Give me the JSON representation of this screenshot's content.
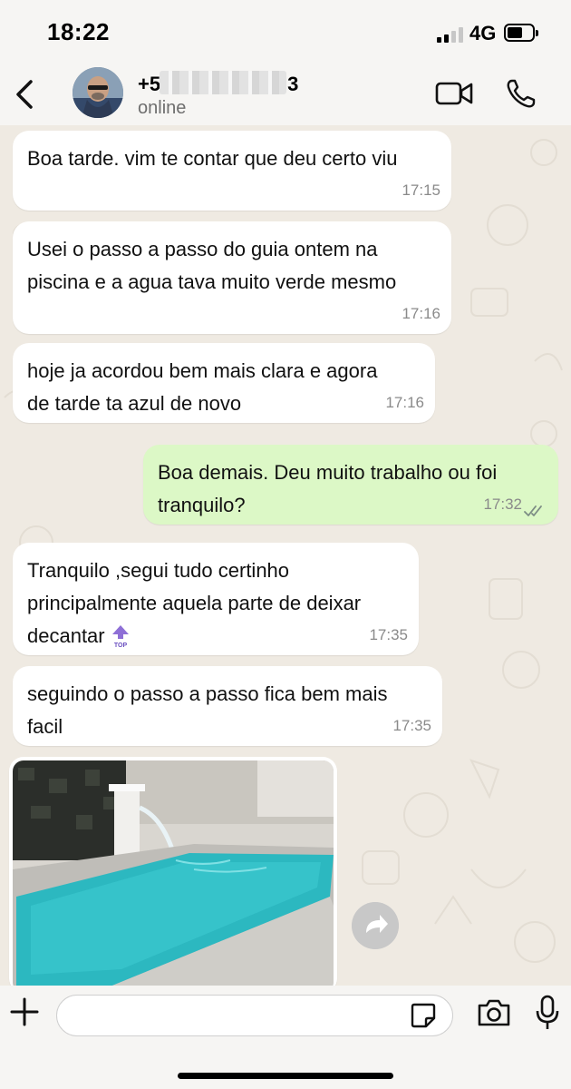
{
  "status_bar": {
    "time": "18:22",
    "network": "4G"
  },
  "header": {
    "contact_prefix": "+5",
    "contact_suffix": "3",
    "presence": "online"
  },
  "messages": [
    {
      "direction": "in",
      "text": "Boa tarde. vim te contar que deu certo viu",
      "time": "17:15"
    },
    {
      "direction": "in",
      "text": "Usei o passo a passo do guia ontem na\npiscina e a agua tava muito verde mesmo",
      "time": "17:16"
    },
    {
      "direction": "in",
      "text": "hoje ja acordou bem mais clara e agora\nde tarde ta azul de novo",
      "time": "17:16"
    },
    {
      "direction": "out",
      "text": "Boa demais. Deu muito trabalho ou foi\ntranquilo?",
      "time": "17:32",
      "status": "read"
    },
    {
      "direction": "in",
      "text": "Tranquilo ,segui tudo certinho\nprincipalmente aquela parte de deixar\ndecantar",
      "time": "17:35",
      "emoji": "top-arrow-emoji"
    },
    {
      "direction": "in",
      "text": "seguindo o passo a passo fica bem mais\nfacil",
      "time": "17:35"
    }
  ],
  "photo": {
    "description_icon": "pool-photo"
  },
  "composer": {
    "value": "",
    "placeholder": ""
  },
  "colors": {
    "incoming_bubble": "#ffffff",
    "outgoing_bubble": "#dcf8c6",
    "chat_background": "#efeae2",
    "read_check": "#53bdeb"
  }
}
